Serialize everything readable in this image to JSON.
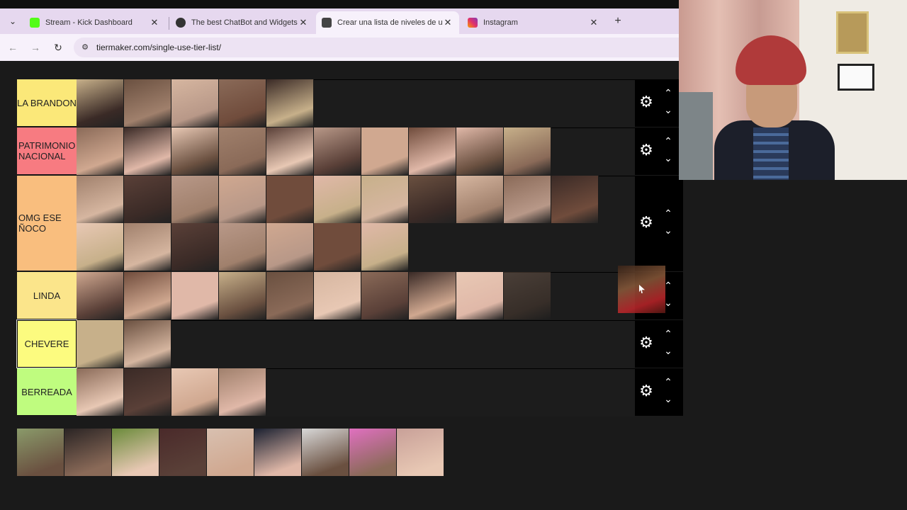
{
  "browser": {
    "tabs": [
      {
        "label": "Stream - Kick Dashboard",
        "favicon_color": "#53fc18"
      },
      {
        "label": "The best ChatBot and Widgets",
        "favicon_color": "#333333"
      },
      {
        "label": "Crear una lista de niveles de un",
        "favicon_color": "#444444"
      },
      {
        "label": "Instagram",
        "favicon_color": "#e1306c"
      }
    ],
    "active_tab_index": 2,
    "close_glyph": "✕",
    "new_tab_glyph": "+",
    "menu_glyph": "⌄",
    "back_glyph": "←",
    "forward_glyph": "→",
    "reload_glyph": "↻",
    "site_info_glyph": "⚙",
    "url": "tiermaker.com/single-use-tier-list/"
  },
  "tiers": [
    {
      "label": "LA BRANDON",
      "color": "#fbe879",
      "item_count": 5
    },
    {
      "label": "PATRIMONIO NACIONAL",
      "color": "#f77b81",
      "item_count": 10
    },
    {
      "label": "OMG ESE ÑOCO",
      "color": "#f9be7e",
      "item_count": 18
    },
    {
      "label": "LINDA",
      "color": "#fbe58b",
      "item_count": 10
    },
    {
      "label": "CHEVERE",
      "color": "#fcfb7f",
      "item_count": 2
    },
    {
      "label": "BERREADA",
      "color": "#bffc7f",
      "item_count": 4
    }
  ],
  "controls": {
    "settings_glyph": "⚙",
    "up_glyph": "⌃",
    "down_glyph": "⌄"
  },
  "pool": {
    "item_count": 9
  }
}
